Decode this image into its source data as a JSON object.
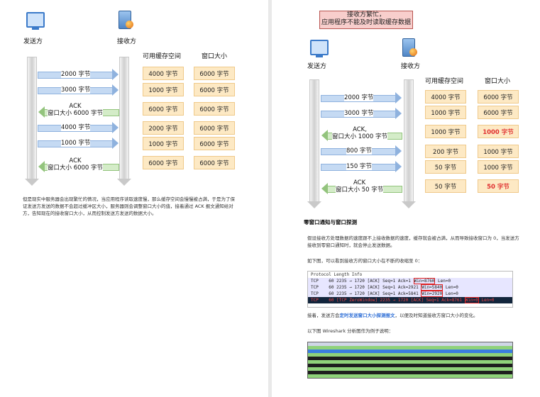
{
  "left": {
    "sender": "发送方",
    "receiver": "接收方",
    "col_buffer": "可用缓存空间",
    "col_window": "窗口大小",
    "messages": [
      {
        "text": "2000 字节",
        "dir": "right"
      },
      {
        "text": "3000 字节",
        "dir": "right"
      },
      {
        "text": "ACK\n窗口大小 6000 字节",
        "dir": "left"
      },
      {
        "text": "4000 字节",
        "dir": "right"
      },
      {
        "text": "1000 字节",
        "dir": "right"
      },
      {
        "text": "ACK\n窗口大小 6000 字节",
        "dir": "left"
      }
    ],
    "buffers": [
      "4000 字节",
      "1000 字节",
      "6000 字节",
      "2000 字节",
      "1000 字节",
      "6000 字节"
    ],
    "windows": [
      "6000 字节",
      "6000 字节",
      "6000 字节",
      "6000 字节",
      "6000 字节",
      "6000 字节"
    ],
    "paragraph": "但是现实中服务器会出现繁忙的情况，当应用程序读取速度慢，那么缓存空间会慢慢被占满，于是为了保证发送方发送的数据不会超过缓冲区大小，服务器则会调整窗口大小的值，接着通过 ACK 报文通知给对方，告知现在的接收窗口大小，从而控制发送方发送的数据大小。"
  },
  "right": {
    "banner": "接收方繁忙，\n应用程序不能及时读取缓存数据",
    "sender": "发送方",
    "receiver": "接收方",
    "col_buffer": "可用缓存空间",
    "col_window": "窗口大小",
    "messages": [
      {
        "text": "2000 字节",
        "dir": "right"
      },
      {
        "text": "3000 字节",
        "dir": "right"
      },
      {
        "text": "ACK,\n窗口大小 1000 字节",
        "dir": "left"
      },
      {
        "text": "800 字节",
        "dir": "right"
      },
      {
        "text": "150 字节",
        "dir": "right"
      },
      {
        "text": "ACK\n窗口大小 50 字节",
        "dir": "left"
      }
    ],
    "buffers": [
      "4000 字节",
      "1000 字节",
      "1000 字节",
      "200 字节",
      "50 字节",
      "50 字节"
    ],
    "windows": [
      "6000 字节",
      "6000 字节",
      "1000 字节",
      "1000 字节",
      "1000 字节",
      "50 字节"
    ],
    "section_title": "零窗口通知与窗口探测",
    "para1": "假设接收方处理数据的速度跟不上接收数据的速度，缓存就会被占满，从而导致接收窗口为 0，当发送方接收到零窗口通知时，就会停止发送数据。",
    "para2": "如下图，可以看到接收方的窗口大小在不断的收缩至 0：",
    "ws_header": "Protocol  Length  Info",
    "ws_rows": [
      {
        "proto": "TCP",
        "info": "60 2235 → 1720 [ACK] Seq=1 Ack=1 ",
        "win": "Win=8760",
        "tail": " Len=0"
      },
      {
        "proto": "TCP",
        "info": "60 2235 → 1720 [ACK] Seq=1 Ack=2921 ",
        "win": "Win=5840",
        "tail": " Len=0"
      },
      {
        "proto": "TCP",
        "info": "60 2235 → 1720 [ACK] Seq=1 Ack=5841 ",
        "win": "Win=2920",
        "tail": " Len=0"
      },
      {
        "proto": "TCP",
        "info": "60 [TCP ZeroWindow] 2235 → 1720 [ACK] Seq=1 Ack=8761 ",
        "win": "Win=0",
        "tail": " Len=0"
      }
    ],
    "para3_pre": "接着，发送方会",
    "para3_link": "定时发送窗口大小探测报文",
    "para3_post": "，以便及时知道接收方窗口大小的变化。",
    "para4": "以下图 Wireshark 分析图作为例子说明："
  }
}
